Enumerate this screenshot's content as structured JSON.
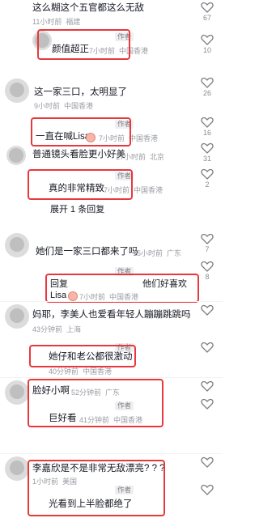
{
  "comments": [
    {
      "text": "这么糊这个五官都这么无敌",
      "time": "11小时前",
      "location": "福建",
      "likes": "67"
    },
    {
      "reply_text": "颜值超正",
      "author_badge": "作者",
      "time": "7小时前",
      "location": "中国香港",
      "likes": "10"
    },
    {
      "text": "这一家三口，太明显了",
      "time": "9小时前",
      "location": "中国香港",
      "likes": "26"
    },
    {
      "reply_text": "一直在喊Lisa",
      "author_badge": "作者",
      "time": "7小时前",
      "location": "中国香港",
      "likes": "16"
    },
    {
      "text": "普通镜头看脸更小好美",
      "time": "17小时前",
      "location": "北京",
      "likes": "31"
    },
    {
      "reply_text": "真的非常精致",
      "author_badge": "作者",
      "time": "7小时前",
      "location": "中国香港",
      "likes": "2"
    },
    {
      "expand_label": "展开 1 条回复"
    },
    {
      "text": "她们是一家三口都来了吗",
      "time": "15小时前",
      "location": "广东",
      "likes": "7"
    },
    {
      "reply_text_1": "回复",
      "reply_text_2": "他们好喜欢",
      "reply_text_3": "Lisa",
      "author_badge": "作者",
      "time": "7小时前",
      "location": "中国香港",
      "likes": "8"
    },
    {
      "text": "妈耶，李美人也爱看年轻人蹦蹦跳跳吗",
      "time": "43分钟前",
      "location": "上海",
      "likes": ""
    },
    {
      "reply_text": "她仔和老公都很激动",
      "author_badge": "作者",
      "time": "40分钟前",
      "location": "中国香港",
      "likes": ""
    },
    {
      "text": "脸好小啊",
      "time": "52分钟前",
      "location": "广东",
      "likes": ""
    },
    {
      "reply_text": "巨好看",
      "author_badge": "作者",
      "time": "41分钟前",
      "location": "中国香港",
      "likes": ""
    },
    {
      "text": "李嘉欣是不是非常无敌漂亮? ? ?",
      "time": "1小时前",
      "location": "美国",
      "likes": ""
    },
    {
      "reply_text": "光看到上半脸都绝了",
      "author_badge": "作者",
      "time": "",
      "location": "",
      "likes": ""
    }
  ],
  "colors": {
    "highlight": "#e8383d",
    "meta": "#9a9ca3"
  }
}
